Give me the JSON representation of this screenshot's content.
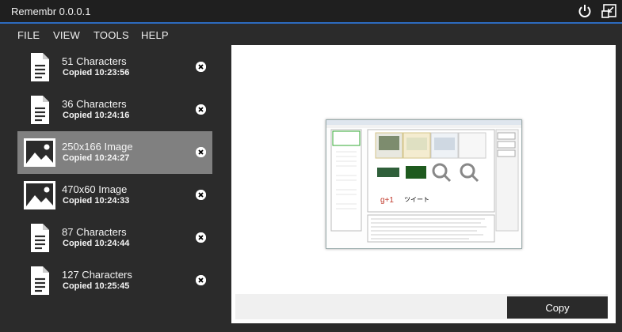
{
  "app": {
    "title": "Remembr 0.0.0.1"
  },
  "menu": [
    "FILE",
    "VIEW",
    "TOOLS",
    "HELP"
  ],
  "clips": [
    {
      "kind": "text-document-icon",
      "title": "51 Characters",
      "time": "Copied 10:23:56",
      "selected": false
    },
    {
      "kind": "text-document-icon",
      "title": "36 Characters",
      "time": "Copied 10:24:16",
      "selected": false
    },
    {
      "kind": "image-icon",
      "title": "250x166 Image",
      "time": "Copied 10:24:27",
      "selected": true
    },
    {
      "kind": "image-icon",
      "title": "470x60 Image",
      "time": "Copied 10:24:33",
      "selected": false
    },
    {
      "kind": "text-document-icon",
      "title": "87 Characters",
      "time": "Copied 10:24:44",
      "selected": false
    },
    {
      "kind": "text-document-icon",
      "title": "127 Characters",
      "time": "Copied 10:25:45",
      "selected": false
    }
  ],
  "preview": {
    "copy_label": "Copy"
  },
  "colors": {
    "accent": "#2c6bbf",
    "selected": "#808080",
    "background": "#2b2b2b"
  }
}
